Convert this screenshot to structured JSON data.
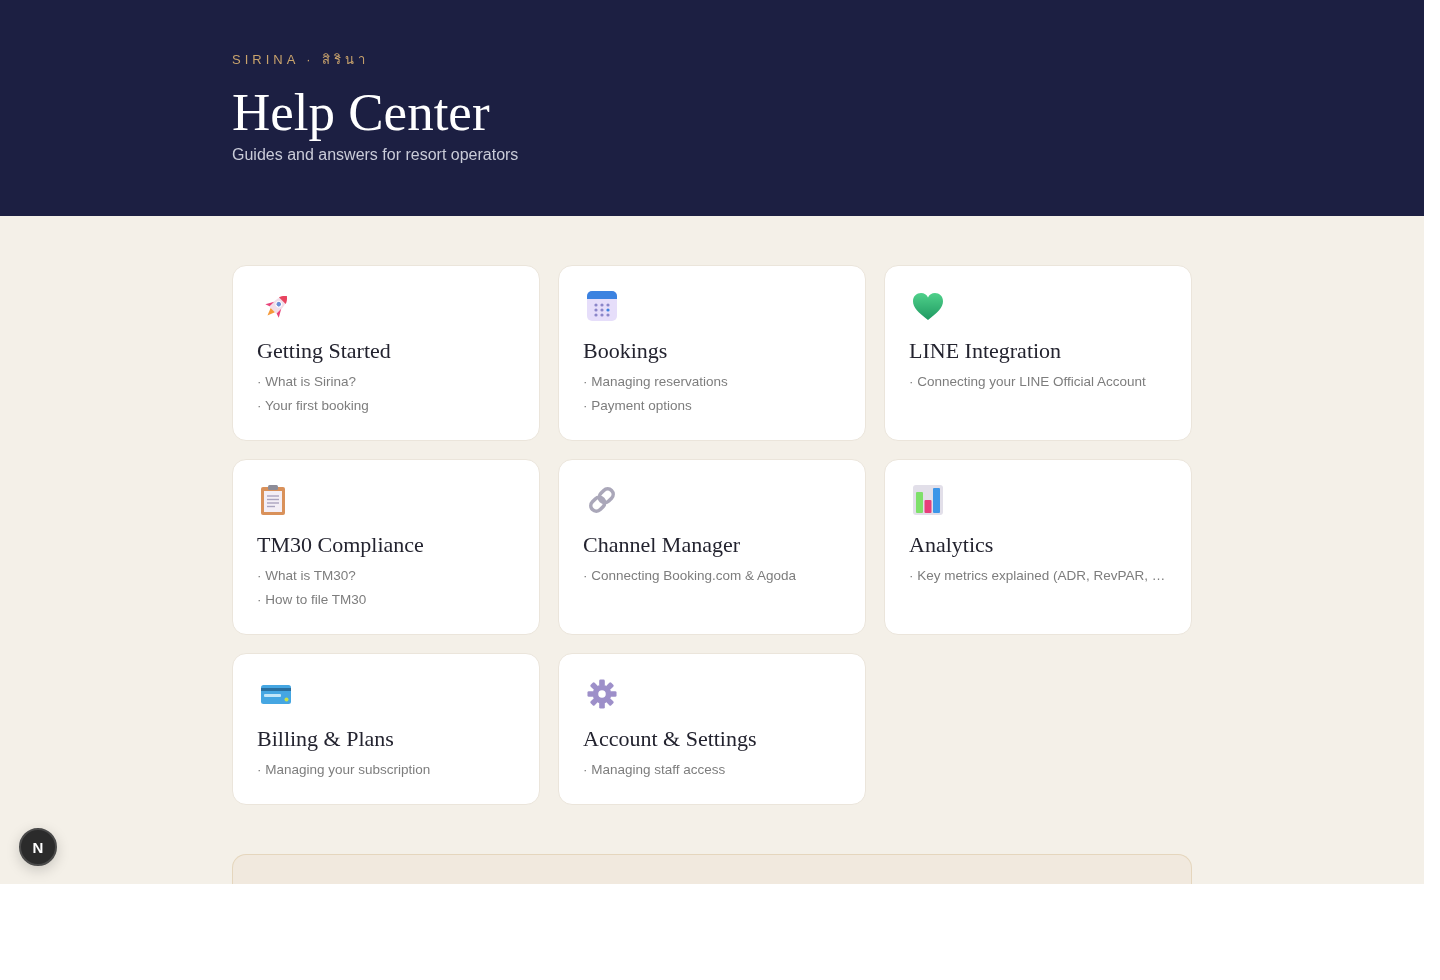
{
  "header": {
    "brand": "SIRINA · สิรินา",
    "title": "Help Center",
    "subtitle": "Guides and answers for resort operators"
  },
  "categories": [
    {
      "title": "Getting Started",
      "articles": [
        "· What is Sirina?",
        "· Your first booking"
      ]
    },
    {
      "title": "Bookings",
      "articles": [
        "· Managing reservations",
        "· Payment options"
      ]
    },
    {
      "title": "LINE Integration",
      "articles": [
        "· Connecting your LINE Official Account"
      ]
    },
    {
      "title": "TM30 Compliance",
      "articles": [
        "· What is TM30?",
        "· How to file TM30"
      ]
    },
    {
      "title": "Channel Manager",
      "articles": [
        "· Connecting Booking.com & Agoda"
      ]
    },
    {
      "title": "Analytics",
      "articles": [
        "· Key metrics explained (ADR, RevPAR, …"
      ]
    },
    {
      "title": "Billing & Plans",
      "articles": [
        "· Managing your subscription"
      ]
    },
    {
      "title": "Account & Settings",
      "articles": [
        "· Managing staff access"
      ]
    }
  ],
  "dev_badge": {
    "label": "N"
  }
}
